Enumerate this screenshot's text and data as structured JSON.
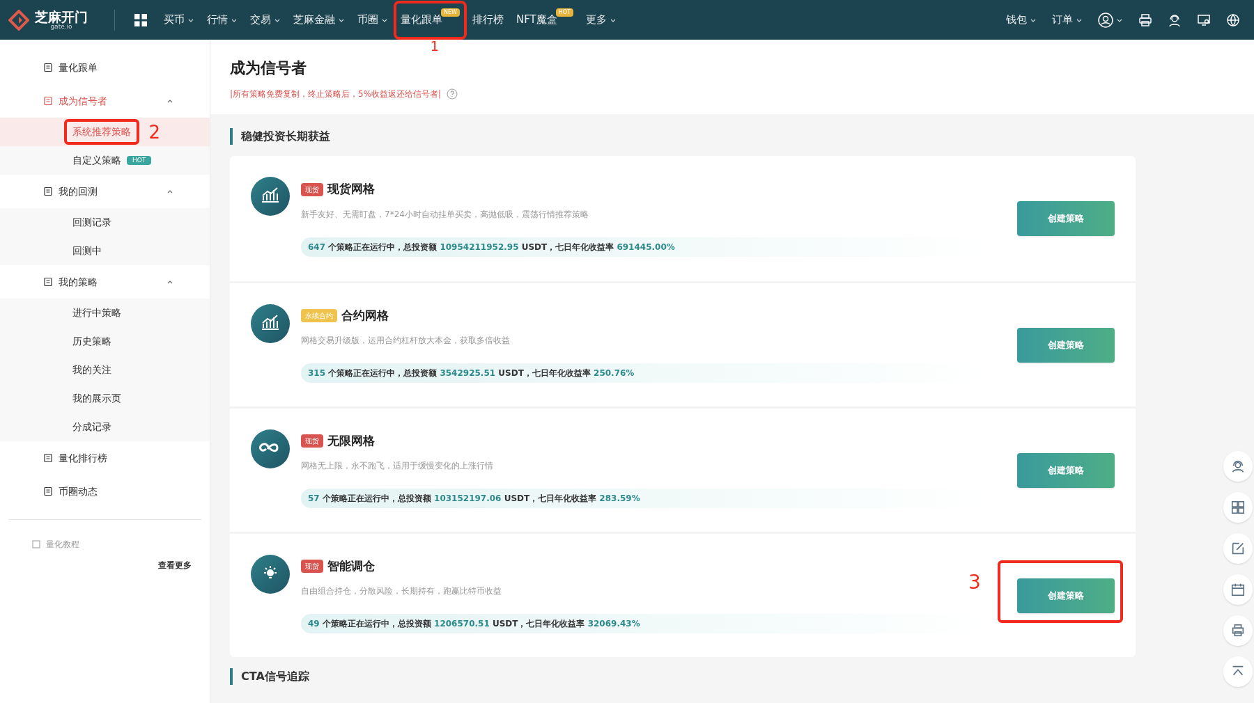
{
  "top_nav": {
    "logo": {
      "name": "芝麻开门",
      "domain": "gate.io"
    },
    "menu": [
      {
        "label": "买币",
        "dropdown": true
      },
      {
        "label": "行情",
        "dropdown": true
      },
      {
        "label": "交易",
        "dropdown": true
      },
      {
        "label": "芝麻金融",
        "dropdown": true
      },
      {
        "label": "币圈",
        "dropdown": true
      },
      {
        "label": "量化跟单",
        "dropdown": false,
        "badge": "NEW"
      },
      {
        "label": "排行榜",
        "dropdown": false
      },
      {
        "label": "NFT魔盒",
        "dropdown": false,
        "badge": "HOT"
      },
      {
        "label": "更多",
        "dropdown": true
      }
    ],
    "right_menu": [
      {
        "label": "钱包",
        "dropdown": true
      },
      {
        "label": "订单",
        "dropdown": true
      }
    ]
  },
  "sidebar": {
    "items": [
      {
        "label": "量化跟单",
        "selected": false
      },
      {
        "label": "成为信号者",
        "selected": true,
        "expanded": true,
        "children": [
          {
            "label": "系统推荐策略",
            "selected": true
          },
          {
            "label": "自定义策略",
            "selected": false,
            "badge": "HOT"
          }
        ]
      },
      {
        "label": "我的回测",
        "selected": false,
        "expanded": true,
        "children": [
          {
            "label": "回测记录",
            "selected": false
          },
          {
            "label": "回测中",
            "selected": false
          }
        ]
      },
      {
        "label": "我的策略",
        "selected": false,
        "expanded": true,
        "children": [
          {
            "label": "进行中策略",
            "selected": false
          },
          {
            "label": "历史策略",
            "selected": false
          },
          {
            "label": "我的关注",
            "selected": false
          },
          {
            "label": "我的展示页",
            "selected": false
          },
          {
            "label": "分成记录",
            "selected": false
          }
        ]
      },
      {
        "label": "量化排行榜",
        "selected": false
      },
      {
        "label": "币圈动态",
        "selected": false
      }
    ],
    "footer": {
      "label": "量化教程",
      "link": "查看更多"
    }
  },
  "page": {
    "title": "成为信号者",
    "notice": "|所有策略免费复制，终止策略后，5%收益返还给信号者|"
  },
  "sections": [
    {
      "title": "稳健投资长期获益",
      "strategies": [
        {
          "kind": "chart",
          "tag": "现货",
          "color": "#d9534f",
          "name": "现货网格",
          "description": "新手友好、无需盯盘，7*24小时自动挂单买卖，高抛低吸，震荡行情推荐策略",
          "stats": [
            {
              "text": "647",
              "highlight": true
            },
            {
              "text": " 个策略正在运行中，总投资额 ",
              "highlight": false
            },
            {
              "text": "10954211952.95",
              "highlight": true
            },
            {
              "text": " USDT，七日年化收益率 ",
              "highlight": false
            },
            {
              "text": "691445.00%",
              "highlight": true
            }
          ],
          "button": "创建策略"
        },
        {
          "kind": "chart",
          "tag": "永续合约",
          "color": "#f0c44c",
          "name": "合约网格",
          "description": "网格交易升级版，运用合约杠杆放大本金，获取多倍收益",
          "stats": [
            {
              "text": "315",
              "highlight": true
            },
            {
              "text": " 个策略正在运行中，总投资额 ",
              "highlight": false
            },
            {
              "text": "3542925.51",
              "highlight": true
            },
            {
              "text": " USDT，七日年化收益率 ",
              "highlight": false
            },
            {
              "text": "250.76%",
              "highlight": true
            }
          ],
          "button": "创建策略"
        },
        {
          "kind": "loop",
          "tag": "现货",
          "color": "#d9534f",
          "name": "无限网格",
          "description": "网格无上限，永不跑飞，适用于缓慢变化的上涨行情",
          "stats": [
            {
              "text": "57",
              "highlight": true
            },
            {
              "text": " 个策略正在运行中，总投资额 ",
              "highlight": false
            },
            {
              "text": "103152197.06",
              "highlight": true
            },
            {
              "text": " USDT，七日年化收益率 ",
              "highlight": false
            },
            {
              "text": "283.59%",
              "highlight": true
            }
          ],
          "button": "创建策略"
        },
        {
          "kind": "bulb",
          "tag": "现货",
          "color": "#d9534f",
          "name": "智能调仓",
          "description": "自由组合持仓，分散风险，长期持有，跑赢比特币收益",
          "stats": [
            {
              "text": "49",
              "highlight": true
            },
            {
              "text": " 个策略正在运行中，总投资额 ",
              "highlight": false
            },
            {
              "text": "1206570.51",
              "highlight": true
            },
            {
              "text": " USDT，七日年化收益率 ",
              "highlight": false
            },
            {
              "text": "32069.43%",
              "highlight": true
            }
          ],
          "button": "创建策略"
        }
      ]
    },
    {
      "title": "CTA信号追踪"
    }
  ],
  "annotations": [
    {
      "label": "1"
    },
    {
      "label": "2"
    },
    {
      "label": "3"
    }
  ]
}
